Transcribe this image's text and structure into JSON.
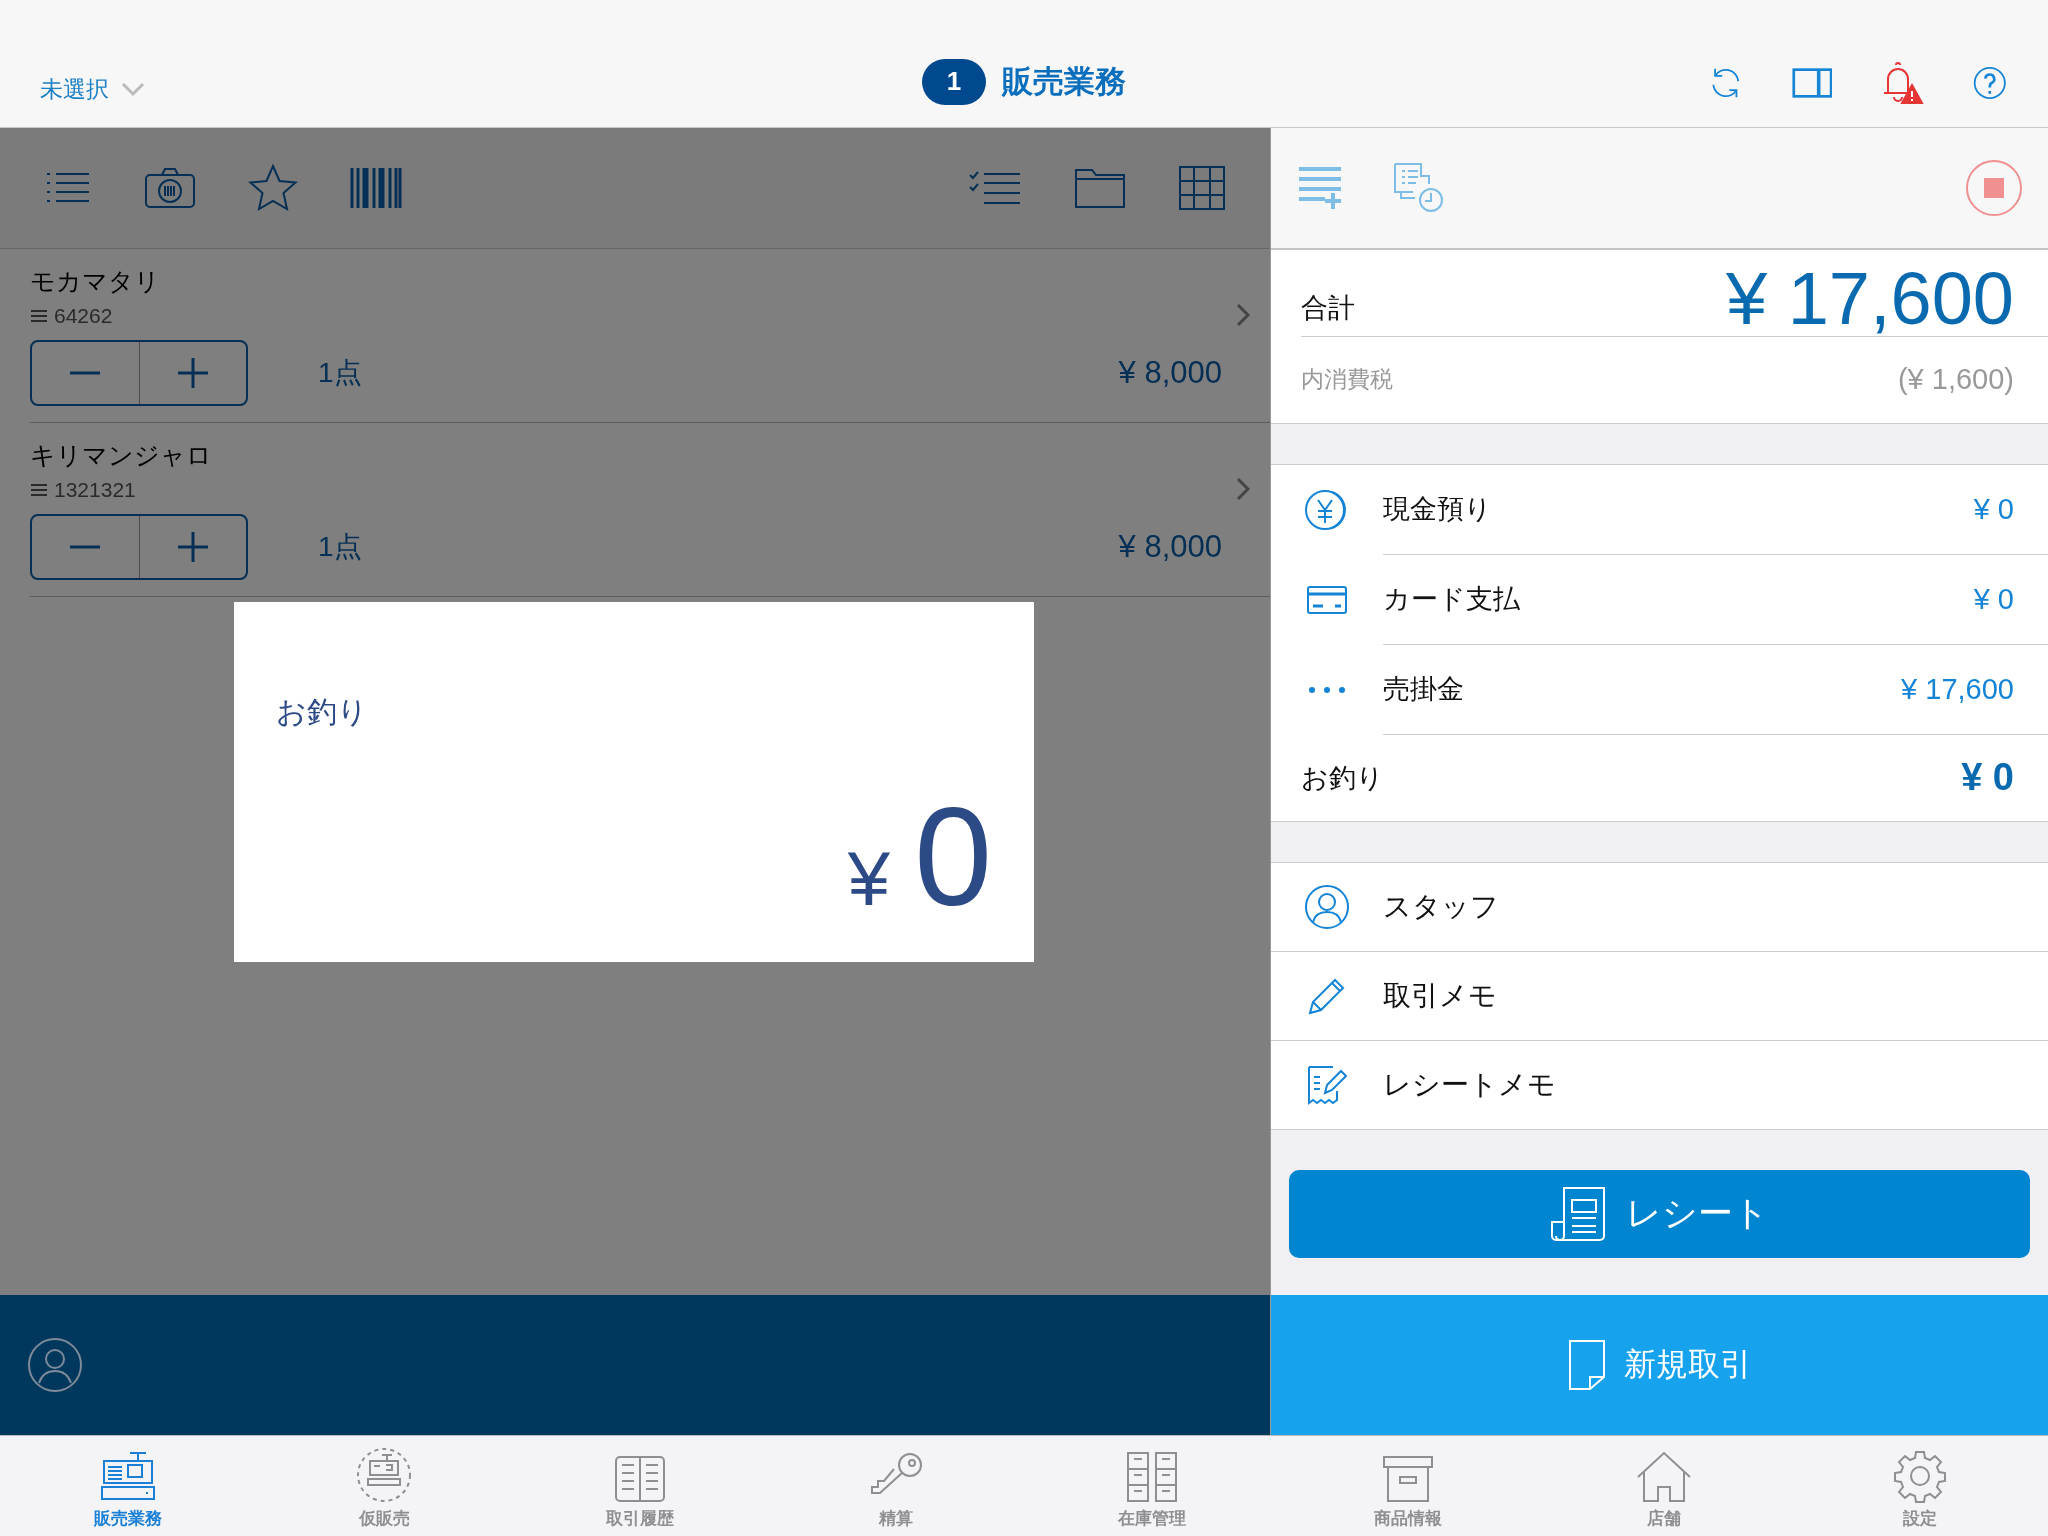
{
  "header": {
    "store_selector": "未選択",
    "register_number": "1",
    "title": "販売業務"
  },
  "cart_items": [
    {
      "name": "モカマタリ",
      "code": "64262",
      "quantity": "1点",
      "price": "¥ 8,000"
    },
    {
      "name": "キリマンジャロ",
      "code": "1321321",
      "quantity": "1点",
      "price": "¥ 8,000"
    }
  ],
  "change_dialog": {
    "label": "お釣り",
    "currency": "¥",
    "amount": "0"
  },
  "summary": {
    "total_label": "合計",
    "total": "¥ 17,600",
    "tax_label": "内消費税",
    "tax": "(¥ 1,600)"
  },
  "payments": [
    {
      "kind": "cash",
      "label": "現金預り",
      "amount": "¥ 0"
    },
    {
      "kind": "card",
      "label": "カード支払",
      "amount": "¥ 0"
    },
    {
      "kind": "other",
      "label": "売掛金",
      "amount": "¥ 17,600"
    }
  ],
  "change": {
    "label": "お釣り",
    "amount": "¥ 0"
  },
  "options": [
    {
      "kind": "staff",
      "label": "スタッフ"
    },
    {
      "kind": "memo",
      "label": "取引メモ"
    },
    {
      "kind": "receipt_memo",
      "label": "レシートメモ"
    }
  ],
  "receipt_button": "レシート",
  "new_transaction_button": "新規取引",
  "tabs": [
    {
      "kind": "register",
      "label": "販売業務",
      "selected": true
    },
    {
      "kind": "provisional",
      "label": "仮販売",
      "selected": false
    },
    {
      "kind": "history",
      "label": "取引履歴",
      "selected": false
    },
    {
      "kind": "settlement",
      "label": "精算",
      "selected": false
    },
    {
      "kind": "inventory",
      "label": "在庫管理",
      "selected": false
    },
    {
      "kind": "products",
      "label": "商品情報",
      "selected": false
    },
    {
      "kind": "store",
      "label": "店舗",
      "selected": false
    },
    {
      "kind": "settings",
      "label": "設定",
      "selected": false
    }
  ]
}
